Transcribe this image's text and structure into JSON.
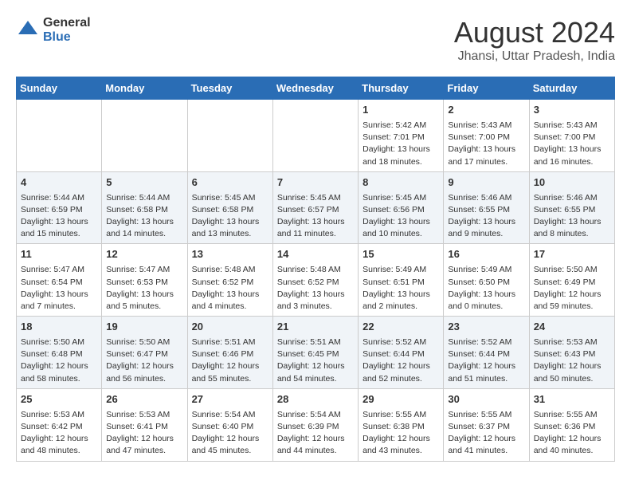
{
  "logo": {
    "general": "General",
    "blue": "Blue"
  },
  "header": {
    "month_year": "August 2024",
    "location": "Jhansi, Uttar Pradesh, India"
  },
  "days_of_week": [
    "Sunday",
    "Monday",
    "Tuesday",
    "Wednesday",
    "Thursday",
    "Friday",
    "Saturday"
  ],
  "weeks": [
    [
      {
        "day": "",
        "content": ""
      },
      {
        "day": "",
        "content": ""
      },
      {
        "day": "",
        "content": ""
      },
      {
        "day": "",
        "content": ""
      },
      {
        "day": "1",
        "content": "Sunrise: 5:42 AM\nSunset: 7:01 PM\nDaylight: 13 hours\nand 18 minutes."
      },
      {
        "day": "2",
        "content": "Sunrise: 5:43 AM\nSunset: 7:00 PM\nDaylight: 13 hours\nand 17 minutes."
      },
      {
        "day": "3",
        "content": "Sunrise: 5:43 AM\nSunset: 7:00 PM\nDaylight: 13 hours\nand 16 minutes."
      }
    ],
    [
      {
        "day": "4",
        "content": "Sunrise: 5:44 AM\nSunset: 6:59 PM\nDaylight: 13 hours\nand 15 minutes."
      },
      {
        "day": "5",
        "content": "Sunrise: 5:44 AM\nSunset: 6:58 PM\nDaylight: 13 hours\nand 14 minutes."
      },
      {
        "day": "6",
        "content": "Sunrise: 5:45 AM\nSunset: 6:58 PM\nDaylight: 13 hours\nand 13 minutes."
      },
      {
        "day": "7",
        "content": "Sunrise: 5:45 AM\nSunset: 6:57 PM\nDaylight: 13 hours\nand 11 minutes."
      },
      {
        "day": "8",
        "content": "Sunrise: 5:45 AM\nSunset: 6:56 PM\nDaylight: 13 hours\nand 10 minutes."
      },
      {
        "day": "9",
        "content": "Sunrise: 5:46 AM\nSunset: 6:55 PM\nDaylight: 13 hours\nand 9 minutes."
      },
      {
        "day": "10",
        "content": "Sunrise: 5:46 AM\nSunset: 6:55 PM\nDaylight: 13 hours\nand 8 minutes."
      }
    ],
    [
      {
        "day": "11",
        "content": "Sunrise: 5:47 AM\nSunset: 6:54 PM\nDaylight: 13 hours\nand 7 minutes."
      },
      {
        "day": "12",
        "content": "Sunrise: 5:47 AM\nSunset: 6:53 PM\nDaylight: 13 hours\nand 5 minutes."
      },
      {
        "day": "13",
        "content": "Sunrise: 5:48 AM\nSunset: 6:52 PM\nDaylight: 13 hours\nand 4 minutes."
      },
      {
        "day": "14",
        "content": "Sunrise: 5:48 AM\nSunset: 6:52 PM\nDaylight: 13 hours\nand 3 minutes."
      },
      {
        "day": "15",
        "content": "Sunrise: 5:49 AM\nSunset: 6:51 PM\nDaylight: 13 hours\nand 2 minutes."
      },
      {
        "day": "16",
        "content": "Sunrise: 5:49 AM\nSunset: 6:50 PM\nDaylight: 13 hours\nand 0 minutes."
      },
      {
        "day": "17",
        "content": "Sunrise: 5:50 AM\nSunset: 6:49 PM\nDaylight: 12 hours\nand 59 minutes."
      }
    ],
    [
      {
        "day": "18",
        "content": "Sunrise: 5:50 AM\nSunset: 6:48 PM\nDaylight: 12 hours\nand 58 minutes."
      },
      {
        "day": "19",
        "content": "Sunrise: 5:50 AM\nSunset: 6:47 PM\nDaylight: 12 hours\nand 56 minutes."
      },
      {
        "day": "20",
        "content": "Sunrise: 5:51 AM\nSunset: 6:46 PM\nDaylight: 12 hours\nand 55 minutes."
      },
      {
        "day": "21",
        "content": "Sunrise: 5:51 AM\nSunset: 6:45 PM\nDaylight: 12 hours\nand 54 minutes."
      },
      {
        "day": "22",
        "content": "Sunrise: 5:52 AM\nSunset: 6:44 PM\nDaylight: 12 hours\nand 52 minutes."
      },
      {
        "day": "23",
        "content": "Sunrise: 5:52 AM\nSunset: 6:44 PM\nDaylight: 12 hours\nand 51 minutes."
      },
      {
        "day": "24",
        "content": "Sunrise: 5:53 AM\nSunset: 6:43 PM\nDaylight: 12 hours\nand 50 minutes."
      }
    ],
    [
      {
        "day": "25",
        "content": "Sunrise: 5:53 AM\nSunset: 6:42 PM\nDaylight: 12 hours\nand 48 minutes."
      },
      {
        "day": "26",
        "content": "Sunrise: 5:53 AM\nSunset: 6:41 PM\nDaylight: 12 hours\nand 47 minutes."
      },
      {
        "day": "27",
        "content": "Sunrise: 5:54 AM\nSunset: 6:40 PM\nDaylight: 12 hours\nand 45 minutes."
      },
      {
        "day": "28",
        "content": "Sunrise: 5:54 AM\nSunset: 6:39 PM\nDaylight: 12 hours\nand 44 minutes."
      },
      {
        "day": "29",
        "content": "Sunrise: 5:55 AM\nSunset: 6:38 PM\nDaylight: 12 hours\nand 43 minutes."
      },
      {
        "day": "30",
        "content": "Sunrise: 5:55 AM\nSunset: 6:37 PM\nDaylight: 12 hours\nand 41 minutes."
      },
      {
        "day": "31",
        "content": "Sunrise: 5:55 AM\nSunset: 6:36 PM\nDaylight: 12 hours\nand 40 minutes."
      }
    ]
  ]
}
